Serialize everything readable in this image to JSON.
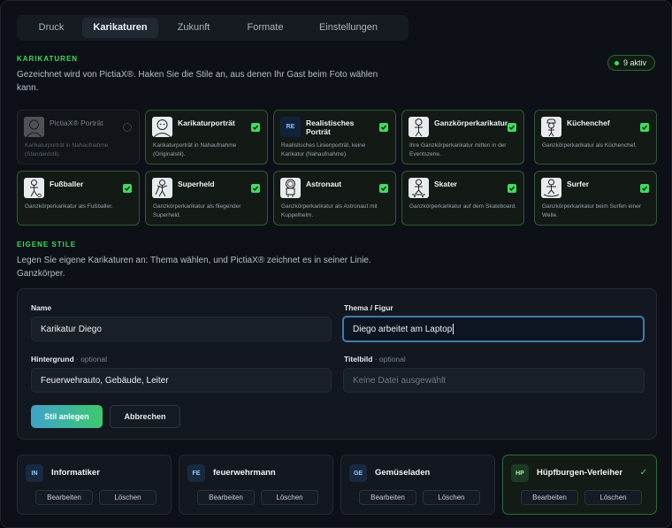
{
  "tabs": [
    "Druck",
    "Karikaturen",
    "Zukunft",
    "Formate",
    "Einstellungen"
  ],
  "caricatures": {
    "title": "KARIKATUREN",
    "description_line1": "Gezeichnet wird von PictiaX®. Haken Sie die Stile an, aus denen Ihr Gast beim Foto wählen",
    "description_line2": "kann.",
    "badge": "9 aktiv"
  },
  "styles": [
    {
      "title": "PictiaX® Porträt",
      "desc": "Karikaturporträt in Nahaufnahme (Standardstil).",
      "enabled": false
    },
    {
      "title": "Karikaturporträt",
      "desc": "Karikaturporträt in Nahaufnahme (Originalstil).",
      "enabled": true
    },
    {
      "title": "Realistisches Porträt",
      "desc": "Realistisches Linienporträt, keine Karikatur (Nahaufnahme).",
      "enabled": true,
      "code": "RE"
    },
    {
      "title": "Ganzkörperkarikatur",
      "desc": "Ihre Ganzkörperkarikatur mitten in der Eventszene.",
      "enabled": true
    },
    {
      "title": "Küchenchef",
      "desc": "Ganzkörperkarikatur als Küchenchef.",
      "enabled": true
    },
    {
      "title": "Fußballer",
      "desc": "Ganzkörperkarikatur als Fußballer.",
      "enabled": true
    },
    {
      "title": "Superheld",
      "desc": "Ganzkörperkarikatur als fliegender Superheld.",
      "enabled": true
    },
    {
      "title": "Astronaut",
      "desc": "Ganzkörperkarikatur als Astronaut mit Kuppelhelm.",
      "enabled": true
    },
    {
      "title": "Skater",
      "desc": "Ganzkörperkarikatur auf dem Skateboard.",
      "enabled": true
    },
    {
      "title": "Surfer",
      "desc": "Ganzkörperkarikatur beim Surfen einer Welle.",
      "enabled": true
    }
  ],
  "own_styles": {
    "title": "EIGENE STILE",
    "description_line1": "Legen Sie eigene Karikaturen an: Thema wählen, und PictiaX® zeichnet es in seiner Linie.",
    "description_line2": "Ganzkörper."
  },
  "form": {
    "name_label": "Name",
    "name_value": "Karikatur Diego",
    "theme_label": "Thema / Figur",
    "theme_value": "Diego arbeitet am Laptop",
    "background_label": "Hintergrund",
    "optional": "· optional",
    "background_value": "Feuerwehrauto, Gebäude, Leiter",
    "cover_label": "Titelbild",
    "cover_placeholder": "Keine Datei ausgewählt",
    "submit": "Stil anlegen",
    "cancel": "Abbrechen"
  },
  "custom_styles": [
    {
      "code": "IN",
      "name": "Informatiker",
      "active": false
    },
    {
      "code": "FE",
      "name": "feuerwehrmann",
      "active": false
    },
    {
      "code": "GE",
      "name": "Gemüseladen",
      "active": false
    },
    {
      "code": "HP",
      "name": "Hüpfburgen-Verleiher",
      "active": true
    }
  ],
  "actions": {
    "edit": "Bearbeiten",
    "delete": "Löschen"
  },
  "colors": {
    "accent_green": "#3ddc5c",
    "focus_blue": "#3d7fa8",
    "background": "#0d1117"
  }
}
